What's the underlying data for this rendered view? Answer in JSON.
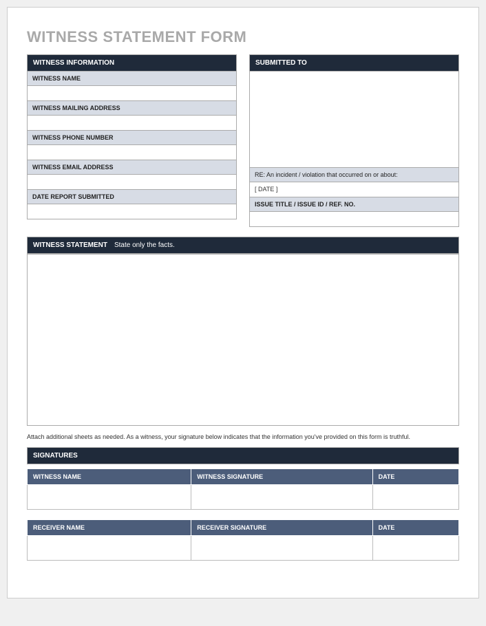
{
  "title": "WITNESS STATEMENT FORM",
  "left": {
    "header": "WITNESS INFORMATION",
    "fields": [
      {
        "label": "WITNESS NAME",
        "value": ""
      },
      {
        "label": "WITNESS MAILING ADDRESS",
        "value": ""
      },
      {
        "label": "WITNESS PHONE NUMBER",
        "value": ""
      },
      {
        "label": "WITNESS EMAIL ADDRESS",
        "value": ""
      },
      {
        "label": "DATE REPORT SUBMITTED",
        "value": ""
      }
    ]
  },
  "right": {
    "header": "SUBMITTED TO",
    "re_label": "RE: An incident / violation that occurred on or about:",
    "date_value": "[ DATE ]",
    "issue_label": "ISSUE TITLE / ISSUE ID / REF. NO.",
    "issue_value": ""
  },
  "statement": {
    "header": "WITNESS STATEMENT",
    "subtext": "State only the facts."
  },
  "note": "Attach additional sheets as needed.  As a witness, your signature below indicates that the information you've provided on this form is truthful.",
  "signatures": {
    "header": "SIGNATURES",
    "tables": [
      {
        "cols": [
          "WITNESS NAME",
          "WITNESS SIGNATURE",
          "DATE"
        ]
      },
      {
        "cols": [
          "RECEIVER NAME",
          "RECEIVER SIGNATURE",
          "DATE"
        ]
      }
    ]
  }
}
